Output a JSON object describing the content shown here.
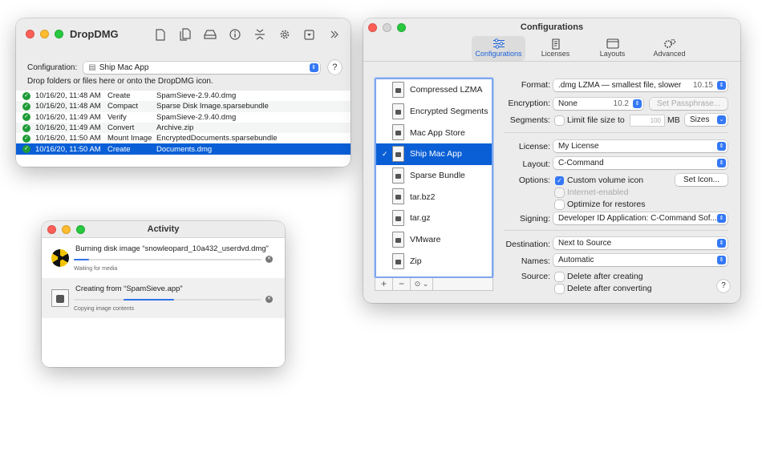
{
  "dropdmg": {
    "title": "DropDMG",
    "toolbar": [
      "new-document-icon",
      "documents-icon",
      "disk-icon",
      "info-icon",
      "compress-icon",
      "gear-icon",
      "dropdown-menu-icon",
      "more-icon"
    ],
    "config_label": "Configuration:",
    "config_value": "Ship Mac App",
    "help": "?",
    "hint": "Drop folders or files here or onto the DropDMG icon.",
    "log": [
      {
        "date": "10/16/20, 11:48 AM",
        "action": "Create",
        "file": "SpamSieve-2.9.40.dmg"
      },
      {
        "date": "10/16/20, 11:48 AM",
        "action": "Compact",
        "file": "Sparse Disk Image.sparsebundle"
      },
      {
        "date": "10/16/20, 11:49 AM",
        "action": "Verify",
        "file": "SpamSieve-2.9.40.dmg"
      },
      {
        "date": "10/16/20, 11:49 AM",
        "action": "Convert",
        "file": "Archive.zip"
      },
      {
        "date": "10/16/20, 11:50 AM",
        "action": "Mount Image",
        "file": "EncryptedDocuments.sparsebundle"
      },
      {
        "date": "10/16/20, 11:50 AM",
        "action": "Create",
        "file": "Documents.dmg"
      }
    ]
  },
  "activity": {
    "title": "Activity",
    "tasks": [
      {
        "name": "Burning disk image “snowleopard_10a432_userdvd.dmg”",
        "status": "Waiting for media",
        "progress": 0.08
      },
      {
        "name": "Creating from “SpamSieve.app”",
        "status": "Copying image contents",
        "progress": 0.27
      }
    ]
  },
  "configurations": {
    "title": "Configurations",
    "tabs": [
      "Configurations",
      "Licenses",
      "Layouts",
      "Advanced"
    ],
    "list": [
      "Compressed LZMA",
      "Encrypted Segments",
      "Mac App Store",
      "Ship Mac App",
      "Sparse Bundle",
      "tar.bz2",
      "tar.gz",
      "VMware",
      "Zip"
    ],
    "selected": "Ship Mac App",
    "buttons": {
      "add": "+",
      "remove": "−",
      "action": "⊙ ⌄"
    },
    "form": {
      "format_label": "Format:",
      "format_value": ".dmg LZMA — smallest file, slower",
      "format_version": "10.15",
      "encryption_label": "Encryption:",
      "encryption_value": "None",
      "encryption_version": "10.2",
      "set_passphrase": "Set Passphrase...",
      "segments_label": "Segments:",
      "segments_check": "Limit file size to",
      "segments_size": "100",
      "segments_unit": "MB",
      "sizes": "Sizes",
      "license_label": "License:",
      "license_value": "My License",
      "layout_label": "Layout:",
      "layout_value": "C-Command",
      "options_label": "Options:",
      "opt_custom_icon": "Custom volume icon",
      "set_icon": "Set Icon...",
      "opt_internet": "Internet-enabled",
      "opt_optimize": "Optimize for restores",
      "signing_label": "Signing:",
      "signing_value": "Developer ID Application: C-Command Sof...",
      "destination_label": "Destination:",
      "destination_value": "Next to Source",
      "names_label": "Names:",
      "names_value": "Automatic",
      "source_label": "Source:",
      "src_delete_create": "Delete after creating",
      "src_delete_convert": "Delete after converting",
      "help": "?"
    }
  }
}
